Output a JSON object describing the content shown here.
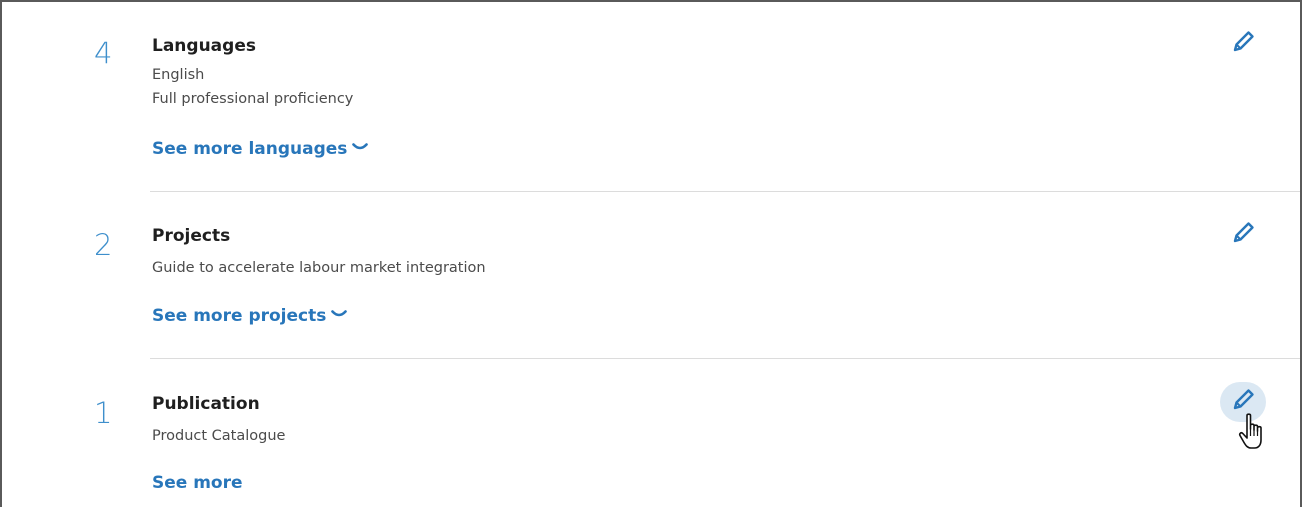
{
  "sections": [
    {
      "count": "4",
      "title": "Languages",
      "details": [
        "English",
        "Full professional proficiency"
      ],
      "more_label": "See more languages",
      "more_icon": "chevron-down-icon",
      "edit_icon": "pencil-icon"
    },
    {
      "count": "2",
      "title": "Projects",
      "details": [
        "Guide to accelerate labour market integration"
      ],
      "more_label": "See more projects",
      "more_icon": "chevron-down-icon",
      "edit_icon": "pencil-icon"
    },
    {
      "count": "1",
      "title": "Publication",
      "details": [
        "Product Catalogue"
      ],
      "more_label": "See more",
      "edit_icon": "pencil-icon",
      "edit_hovered": true
    }
  ],
  "colors": {
    "accent": "#2876ba",
    "count": "#3e8fcc",
    "title": "#1f1f1f",
    "detail": "#4b4b4b",
    "divider": "#dcdcdc",
    "hover_bg": "#dbe8f3"
  },
  "cursor_icon": "hand-pointer-icon"
}
